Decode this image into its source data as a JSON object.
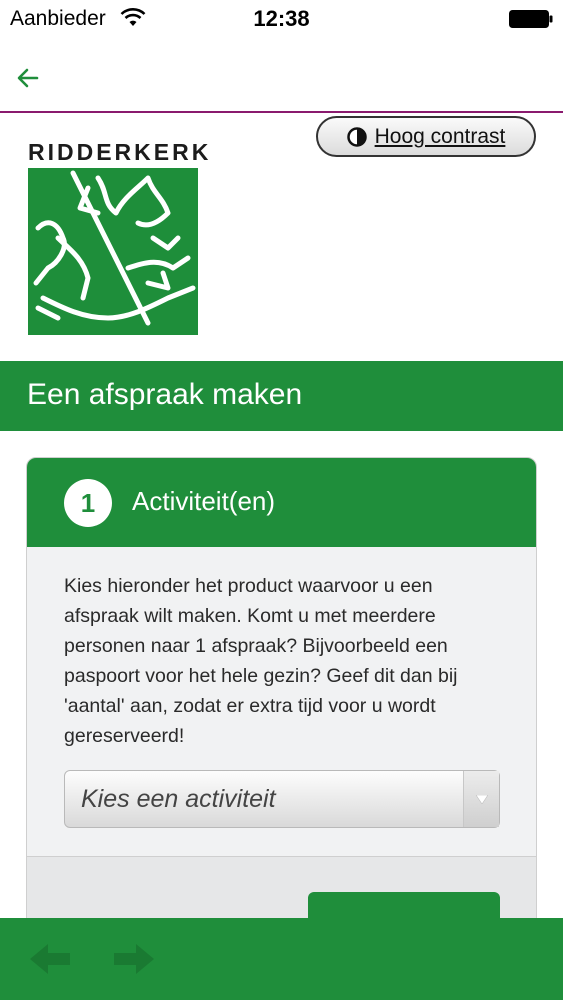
{
  "status_bar": {
    "carrier": "Aanbieder",
    "time": "12:38"
  },
  "header": {
    "brand": "RIDDERKERK",
    "contrast_label": "Hoog contrast"
  },
  "page": {
    "title": "Een afspraak maken"
  },
  "step": {
    "number": "1",
    "title": "Activiteit(en)",
    "instructions": "Kies hieronder het product waarvoor u een afspraak wilt maken. Komt u met meerdere personen naar 1 afspraak? Bijvoorbeeld een paspoort voor het hele gezin? Geef dit dan bij 'aantal' aan, zodat er extra tijd voor u wordt gereserveerd!",
    "select_value": "Kies een activiteit"
  },
  "colors": {
    "brand_green": "#1f8e3b",
    "nav_divider": "#8a1a6e",
    "back_arrow": "#1f8e3b"
  },
  "icons": {
    "nav_back": "arrow-left-icon",
    "contrast": "half-circle-icon",
    "select_arrow": "triangle-down-icon",
    "toolbar_back": "arrow-left-icon",
    "toolbar_forward": "arrow-right-icon"
  }
}
